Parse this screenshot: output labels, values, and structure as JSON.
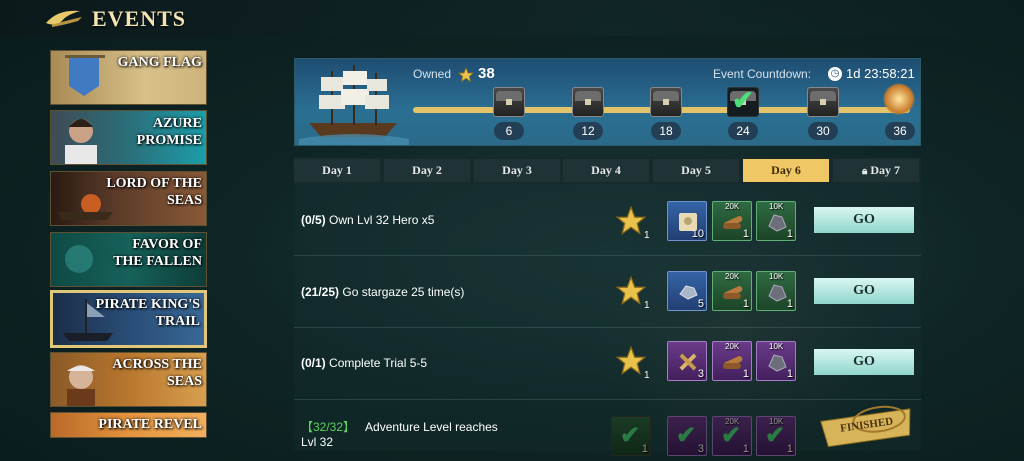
{
  "header": {
    "title": "EVENTS"
  },
  "sidebar": {
    "items": [
      {
        "label": "GANG FLAG"
      },
      {
        "label": "AZURE PROMISE"
      },
      {
        "label": "LORD OF THE SEAS"
      },
      {
        "label": "FAVOR OF THE FALLEN"
      },
      {
        "label": "PIRATE KING'S TRAIL"
      },
      {
        "label": "ACROSS THE SEAS"
      },
      {
        "label": "PIRATE REVEL"
      }
    ],
    "selected": "PIRATE KING'S TRAIL"
  },
  "banner": {
    "owned_label": "Owned",
    "owned_value": "38",
    "countdown_label": "Event Countdown:",
    "countdown_value": "1d 23:58:21",
    "milestones": [
      {
        "value": "6",
        "claimed": false
      },
      {
        "value": "12",
        "claimed": false
      },
      {
        "value": "18",
        "claimed": false
      },
      {
        "value": "24",
        "claimed": true
      },
      {
        "value": "30",
        "claimed": false
      },
      {
        "value": "36",
        "claimed": false
      }
    ]
  },
  "days": [
    {
      "label": "Day 1"
    },
    {
      "label": "Day 2"
    },
    {
      "label": "Day 3"
    },
    {
      "label": "Day 4"
    },
    {
      "label": "Day 5"
    },
    {
      "label": "Day 6"
    },
    {
      "label": "Day 7"
    }
  ],
  "active_day": "Day 6",
  "tasks": [
    {
      "progress": "(0/5)",
      "text": "Own Lvl 32 Hero x5",
      "star_qty": "1",
      "items": [
        {
          "qty": "10",
          "tag": ""
        },
        {
          "qty": "1",
          "tag": "20K"
        },
        {
          "qty": "1",
          "tag": "10K"
        }
      ],
      "button": "GO"
    },
    {
      "progress": "(21/25)",
      "text": "Go stargaze 25 time(s)",
      "star_qty": "1",
      "items": [
        {
          "qty": "5",
          "tag": ""
        },
        {
          "qty": "1",
          "tag": "20K"
        },
        {
          "qty": "1",
          "tag": "10K"
        }
      ],
      "button": "GO"
    },
    {
      "progress": "(0/1)",
      "text": "Complete Trial 5-5",
      "star_qty": "1",
      "items": [
        {
          "qty": "3",
          "tag": ""
        },
        {
          "qty": "1",
          "tag": "20K"
        },
        {
          "qty": "1",
          "tag": "10K"
        }
      ],
      "button": "GO"
    },
    {
      "progress": "【32/32】",
      "text": "Adventure Level reaches",
      "text2": "Lvl 32",
      "star_qty": "1",
      "items": [
        {
          "qty": "3",
          "tag": ""
        },
        {
          "qty": "1",
          "tag": "20K"
        },
        {
          "qty": "1",
          "tag": "10K"
        }
      ],
      "button": "FINISHED"
    }
  ],
  "colors": {
    "accent": "#f0c765",
    "go_button": "#8fd6cc",
    "banner": "#2a6f93",
    "complete_green": "#59d45d"
  },
  "icons": [
    "star-icon",
    "clock-icon",
    "chest-icon",
    "checkmark-icon",
    "scroll-icon",
    "wood-icon",
    "ore-icon",
    "ship-icon",
    "lock-icon"
  ]
}
